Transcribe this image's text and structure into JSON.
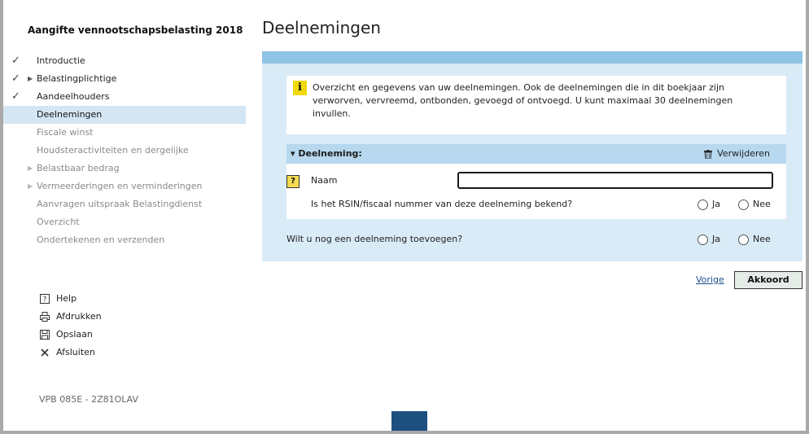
{
  "app": {
    "title": "Aangifte vennootschapsbelasting 2018"
  },
  "sidebar": {
    "items": [
      {
        "label": "Introductie",
        "state": "done",
        "has_caret": false
      },
      {
        "label": "Belastingplichtige",
        "state": "done",
        "has_caret": true
      },
      {
        "label": "Aandeelhouders",
        "state": "done",
        "has_caret": false
      },
      {
        "label": "Deelnemingen",
        "state": "active",
        "has_caret": false
      },
      {
        "label": "Fiscale winst",
        "state": "todo",
        "has_caret": false
      },
      {
        "label": "Houdsteractiviteiten en dergelijke",
        "state": "todo",
        "has_caret": false
      },
      {
        "label": "Belastbaar bedrag",
        "state": "todo",
        "has_caret": true
      },
      {
        "label": "Vermeerderingen en verminderingen",
        "state": "todo",
        "has_caret": true
      },
      {
        "label": "Aanvragen uitspraak Belastingdienst",
        "state": "todo",
        "has_caret": false
      },
      {
        "label": "Overzicht",
        "state": "todo",
        "has_caret": false
      },
      {
        "label": "Ondertekenen en verzenden",
        "state": "todo",
        "has_caret": false
      }
    ],
    "check_glyph": "✓",
    "caret_glyph": "▶"
  },
  "tools": {
    "help": {
      "label": "Help",
      "icon": "help-icon"
    },
    "print": {
      "label": "Afdrukken",
      "icon": "printer-icon"
    },
    "save": {
      "label": "Opslaan",
      "icon": "save-icon"
    },
    "close": {
      "label": "Afsluiten",
      "icon": "close-icon"
    }
  },
  "version": "VPB 085E - 2Z81OLAV",
  "main": {
    "title": "Deelnemingen",
    "info": {
      "icon_glyph": "i",
      "text": "Overzicht en gegevens van uw deelnemingen. Ook de deelnemingen die in dit boekjaar zijn verworven, vervreemd, ontbonden, gevoegd of ontvoegd. U kunt maximaal 30 deelnemingen invullen."
    },
    "section": {
      "title": "▾ Deelneming:",
      "delete_label": "Verwijderen",
      "help_glyph": "?",
      "name_label": "Naam",
      "name_value": "",
      "rsin_question": "Is het RSIN/fiscaal nummer van deze deelneming bekend?",
      "yes": "Ja",
      "no": "Nee"
    },
    "add_question": "Wilt u nog een deelneming toevoegen?",
    "add_yes": "Ja",
    "add_no": "Nee"
  },
  "footer": {
    "prev_label": "Vorige",
    "accept_label": "Akkoord"
  },
  "colors": {
    "panel_bg": "#d9ebf7",
    "panel_top": "#8ec4e4",
    "section_header": "#b7d8ee",
    "active_nav": "#d4e6f4",
    "info_icon": "#f1d80a",
    "bottom_tab": "#1d4f7f"
  }
}
